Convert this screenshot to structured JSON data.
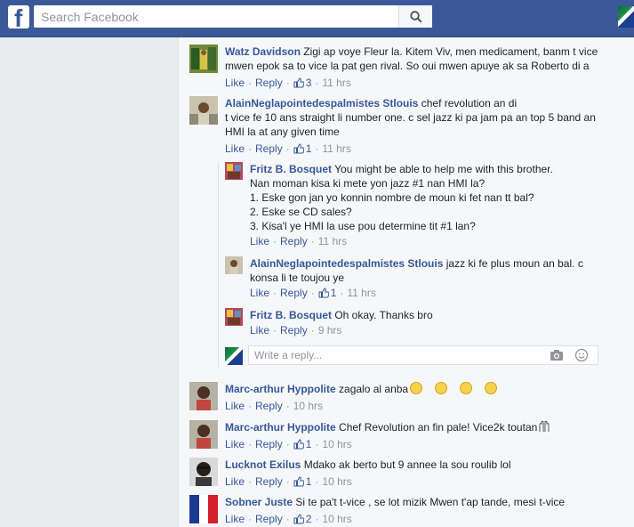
{
  "topbar": {
    "logo": "f",
    "search_placeholder": "Search Facebook",
    "search_icon": "search-icon",
    "brand_color": "#3b5998"
  },
  "comments": [
    {
      "author": "Watz Davidson",
      "text_line1": "Zigi ap voye Fleur la. Kitem Viv, men medicament, banm t vice",
      "text_line2": "mwen epok sa to vice la pat gen rival. So oui mwen apuye ak sa Roberto di a",
      "like": "Like",
      "reply": "Reply",
      "likes": "3",
      "time": "11 hrs"
    },
    {
      "author": "AlainNeglapointedespalmistes Stlouis",
      "text_line1": "chef revolution an di",
      "text_line2": "t vice fe 10 ans straight li number one. c sel jazz ki pa jam pa an top 5 band an",
      "text_line3": "HMI la at any given time",
      "like": "Like",
      "reply": "Reply",
      "likes": "1",
      "time": "11 hrs"
    },
    {
      "author": "Marc-arthur Hyppolite",
      "text": "zagalo al anba",
      "like": "Like",
      "reply": "Reply",
      "time": "10 hrs"
    },
    {
      "author": "Marc-arthur Hyppolite",
      "text": "Chef Revolution an fin pale! Vice2k toutan",
      "like": "Like",
      "reply": "Reply",
      "likes": "1",
      "time": "10 hrs"
    },
    {
      "author": "Lucknot Exilus",
      "text": "Mdako ak berto but 9 annee la sou roulib lol",
      "like": "Like",
      "reply": "Reply",
      "likes": "1",
      "time": "10 hrs"
    },
    {
      "author": "Sobner Juste",
      "text": "Si te pa't t-vice , se lot mizik Mwen t'ap tande, mesi t-vice",
      "like": "Like",
      "reply": "Reply",
      "likes": "2",
      "time": "10 hrs"
    }
  ],
  "replies": [
    {
      "author": "Fritz B. Bosquet",
      "text_line1": "You might be able to help me with this brother.",
      "text_line2": "Nan moman kisa ki mete yon jazz #1 nan HMI la?",
      "text_line3": "1. Eske gon jan yo konnin nombre de moun ki fet nan tt bal?",
      "text_line4": "2. Eske se CD sales?",
      "text_line5": "3. Kisa'l ye HMI la use pou determine tit #1 lan?",
      "like": "Like",
      "reply": "Reply",
      "time": "11 hrs"
    },
    {
      "author": "AlainNeglapointedespalmistes Stlouis",
      "text_line1": "jazz ki fe plus moun an bal. c",
      "text_line2": "konsa li te toujou ye",
      "like": "Like",
      "reply": "Reply",
      "likes": "1",
      "time": "11 hrs"
    },
    {
      "author": "Fritz B. Bosquet",
      "text": "Oh okay. Thanks bro",
      "like": "Like",
      "reply": "Reply",
      "time": "9 hrs"
    }
  ],
  "reply_box": {
    "placeholder": "Write a reply...",
    "camera_icon": "camera-icon",
    "emoji_icon": "smiley-icon"
  },
  "dot": "·"
}
